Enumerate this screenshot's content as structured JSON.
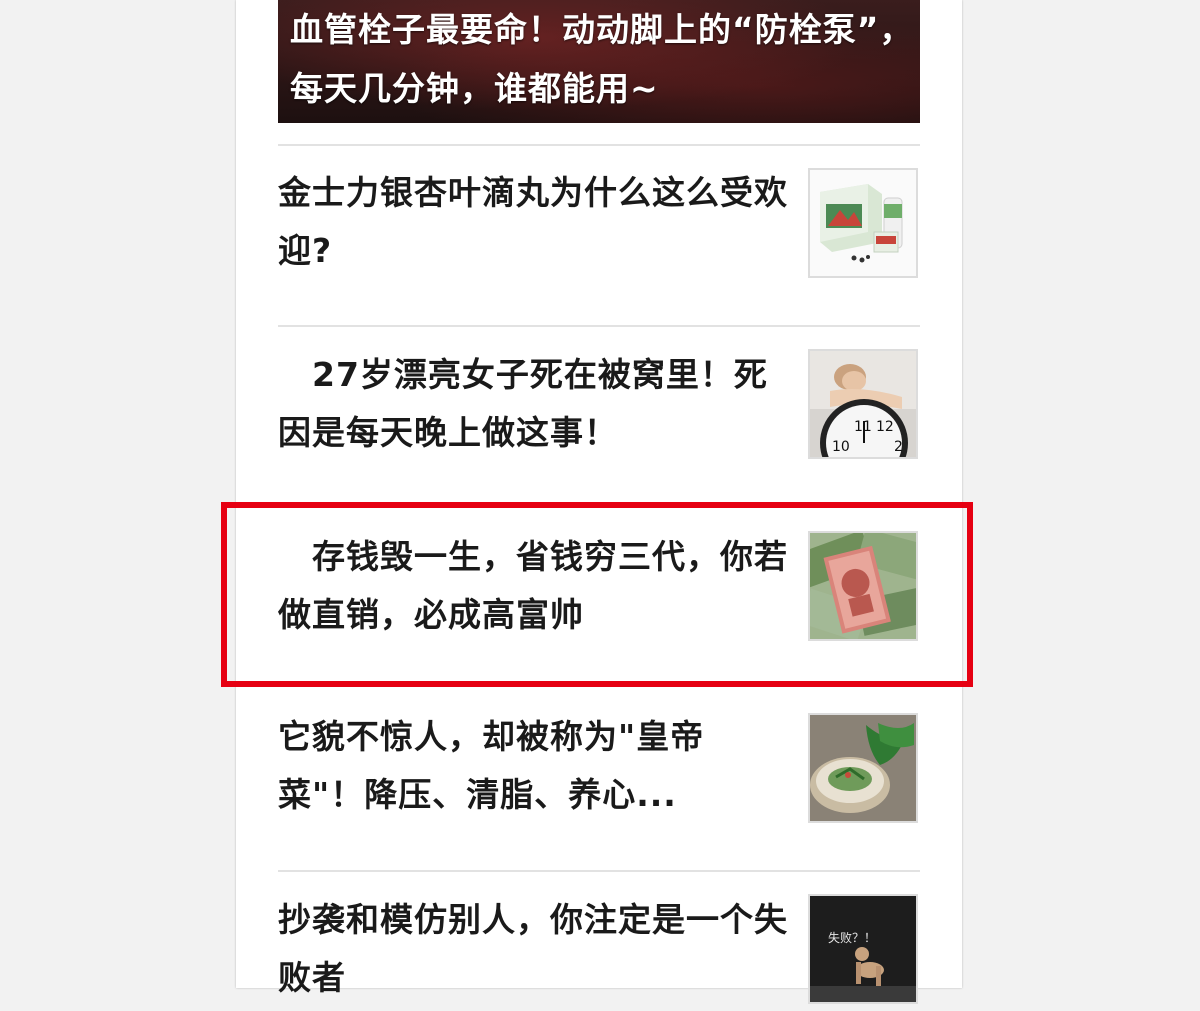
{
  "hero": {
    "title": "血管栓子最要命！动动脚上的“防栓泵”，每天几分钟，谁都能用~"
  },
  "articles": [
    {
      "title": "金士力银杏叶滴丸为什么这么受欢迎?",
      "thumb_icon": "medicine-box-icon"
    },
    {
      "title": "　27岁漂亮女子死在被窝里！死因是每天晚上做这事！",
      "thumb_icon": "sleeping-woman-clock-icon"
    },
    {
      "title": "　存钱毁一生，省钱穷三代，你若做直销，必成高富帅",
      "thumb_icon": "money-banknotes-icon"
    },
    {
      "title": "它貌不惊人，却被称为\"皇帝菜\"！降压、清脂、养心...",
      "thumb_icon": "vegetable-dish-icon"
    },
    {
      "title": "抄袭和模仿别人，你注定是一个失败者",
      "thumb_icon": "failure-figure-icon",
      "thumb_caption": "失败？！"
    }
  ],
  "colors": {
    "highlight": "#e60012",
    "title_text": "#1a1a1a",
    "background": "#f2f2f2"
  }
}
